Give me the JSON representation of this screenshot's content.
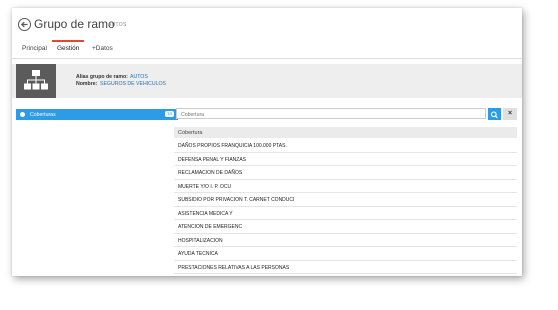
{
  "header": {
    "title": "Grupo de ramo",
    "subtitle": "AUTOS"
  },
  "tabs": [
    {
      "label": "Principal"
    },
    {
      "label": "Gestión"
    },
    {
      "label": "+Datos"
    }
  ],
  "info": {
    "alias_label": "Alias grupo de ramo:",
    "alias_value": "AUTOS",
    "nombre_label": "Nombre:",
    "nombre_value": "SEGUROS DE VEHICULOS"
  },
  "sidebar": {
    "items": [
      {
        "label": "Coberturas",
        "badge": "14"
      }
    ]
  },
  "search": {
    "placeholder": "Cobertura"
  },
  "table": {
    "header": "Cobertura",
    "rows": [
      "DAÑOS PROPIOS FRANQUICIA 100.000 PTAS.",
      "DEFENSA PENAL Y FIANZAS",
      "RECLAMACION DE DAÑOS",
      "MUERTE Y/O I. P. OCU",
      "SUBSIDIO POR PRIVACION T. CARNET CONDUCI",
      "ASISTENCIA MEDICA Y",
      "ATENCION DE EMERGENC",
      "HOSPITALIZACION",
      "AYUDA TECNICA",
      "PRESTACIONES RELATIVAS A LAS PERSONAS"
    ]
  },
  "colors": {
    "accent": "#2d9be6",
    "tab_underline": "#e04a2f",
    "link": "#2a6fb6"
  }
}
